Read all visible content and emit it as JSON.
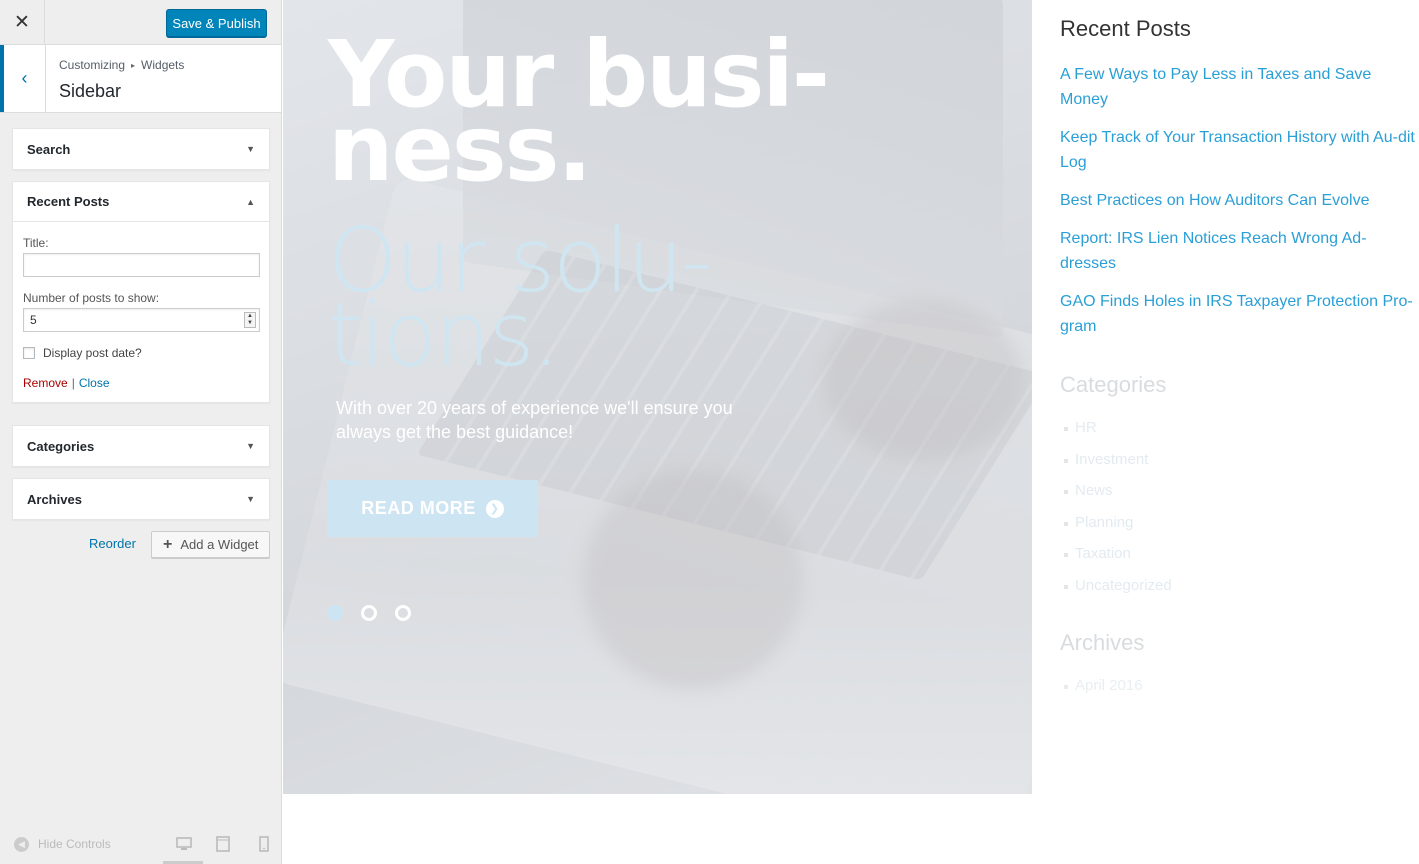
{
  "customizer": {
    "close_icon": "close-icon",
    "publish_label": "Save & Publish",
    "breadcrumb": {
      "root": "Customizing",
      "separator": "▸",
      "current": "Widgets"
    },
    "section_title": "Sidebar",
    "widgets": [
      {
        "title": "Search",
        "expanded": false
      },
      {
        "title": "Recent Posts",
        "expanded": true,
        "fields": {
          "title_label": "Title:",
          "title_value": "",
          "count_label": "Number of posts to show:",
          "count_value": "5",
          "show_date_label": "Display post date?",
          "show_date_checked": false
        },
        "remove_label": "Remove",
        "close_label": "Close",
        "separator": "|"
      },
      {
        "title": "Categories",
        "expanded": false
      },
      {
        "title": "Archives",
        "expanded": false
      }
    ],
    "reorder_label": "Reorder",
    "add_widget_label": "Add a Widget",
    "footer": {
      "hide_controls_label": "Hide Controls",
      "devices": [
        "desktop",
        "tablet",
        "mobile"
      ],
      "active_device": "desktop"
    }
  },
  "hero": {
    "title": "Your busi-ness.",
    "title_line1": "Your busi-",
    "title_line2": "ness.",
    "subtitle_line1": "Our solu-",
    "subtitle_line2": "tions.",
    "text": "With over 20 years of experience we'll ensure you always get the best guidance!",
    "button_label": "READ MORE",
    "slides": 3,
    "active_slide": 0,
    "accent_color": "#cde5f2"
  },
  "preview_sidebar": {
    "recent_posts_title": "Recent Posts",
    "recent_posts": [
      "A Few Ways to Pay Less in Taxes and Save Money",
      "Keep Track of Your Transaction History with Au-dit Log",
      "Best Practices on How Auditors Can Evolve",
      "Report: IRS Lien Notices Reach Wrong Ad-dresses",
      "GAO Finds Holes in IRS Taxpayer Protection Pro-gram"
    ],
    "categories_title": "Categories",
    "categories": [
      "HR",
      "Investment",
      "News",
      "Planning",
      "Taxation",
      "Uncategorized"
    ],
    "archives_title": "Archives",
    "archives": [
      "April 2016"
    ],
    "link_color": "#2a9fd6"
  }
}
